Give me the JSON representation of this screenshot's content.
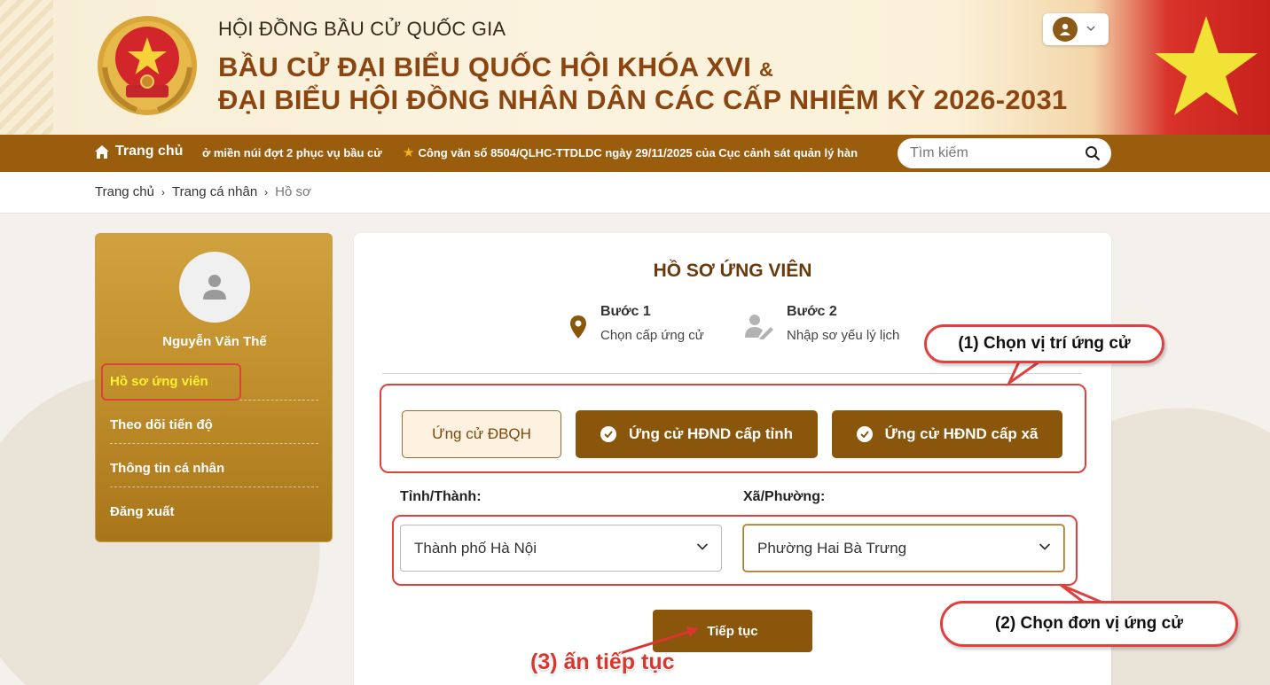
{
  "header": {
    "line1": "HỘI ĐỒNG BẦU CỬ QUỐC GIA",
    "line2": "BẦU CỬ ĐẠI BIỂU QUỐC HỘI KHÓA XVI",
    "line2_amp": "&",
    "line3": "ĐẠI BIỂU HỘI ĐỒNG NHÂN DÂN CÁC CẤP NHIỆM KỲ 2026-2031",
    "emblem_icon": "national-emblem-icon",
    "user_icon": "user-icon"
  },
  "nav": {
    "home": "Trang chủ",
    "ticker1": "ở miền núi đợt 2 phục vụ bầu cử",
    "ticker2": "Công văn số 8504/QLHC-TTDLDC ngày 29/11/2025 của Cục cảnh sát quản lý hàn",
    "search_placeholder": "Tìm kiếm"
  },
  "breadcrumb": {
    "items": [
      "Trang chủ",
      "Trang cá nhân",
      "Hồ sơ"
    ]
  },
  "sidebar": {
    "user_name": "Nguyễn Văn Thế",
    "items": [
      "Hồ sơ ứng viên",
      "Theo dõi tiến độ",
      "Thông tin cá nhân",
      "Đăng xuất"
    ]
  },
  "main": {
    "title": "HỒ SƠ ỨNG VIÊN",
    "steps": [
      {
        "title": "Bước 1",
        "sub": "Chọn cấp ứng cử",
        "icon": "map-pin-icon"
      },
      {
        "title": "Bước 2",
        "sub": "Nhập sơ yếu lý lịch",
        "icon": "user-edit-icon"
      }
    ],
    "options": [
      "Ứng cử ĐBQH",
      "Ứng cử HĐND cấp tỉnh",
      "Ứng cử HĐND cấp xã"
    ],
    "province_label": "Tỉnh/Thành:",
    "province_value": "Thành phố Hà Nội",
    "ward_label": "Xã/Phường:",
    "ward_value": "Phường Hai Bà Trưng",
    "next_button": "Tiếp tục"
  },
  "annotations": {
    "callout1": "(1) Chọn vị trí ứng cử",
    "callout2": "(2) Chọn đơn vị ứng cử",
    "callout3": "(3) ấn tiếp tục"
  },
  "colors": {
    "brand_brown": "#8a560b",
    "nav_brown": "#9a5d0d",
    "annotation_red": "#e0403e",
    "active_yellow": "#fff22e"
  }
}
